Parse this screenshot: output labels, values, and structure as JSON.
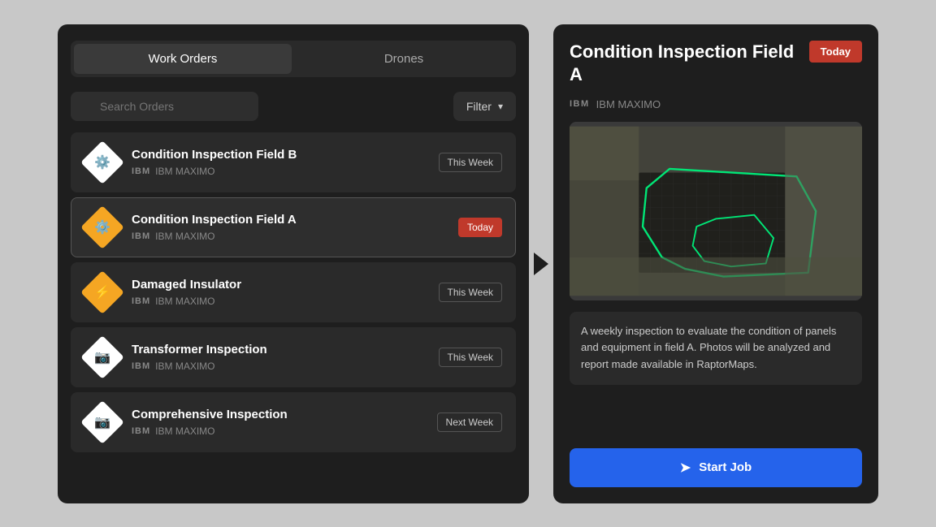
{
  "tabs": {
    "work_orders_label": "Work Orders",
    "drones_label": "Drones"
  },
  "search": {
    "placeholder": "Search Orders",
    "filter_label": "Filter"
  },
  "orders": [
    {
      "title": "Condition Inspection Field B",
      "source": "IBM MAXIMO",
      "badge": "This Week",
      "badge_type": "this-week",
      "icon_type": "gear",
      "icon_color": "white"
    },
    {
      "title": "Condition Inspection Field A",
      "source": "IBM MAXIMO",
      "badge": "Today",
      "badge_type": "today",
      "icon_type": "gear",
      "icon_color": "yellow",
      "selected": true
    },
    {
      "title": "Damaged Insulator",
      "source": "IBM MAXIMO",
      "badge": "This Week",
      "badge_type": "this-week",
      "icon_type": "lightning",
      "icon_color": "yellow"
    },
    {
      "title": "Transformer Inspection",
      "source": "IBM MAXIMO",
      "badge": "This Week",
      "badge_type": "this-week",
      "icon_type": "camera",
      "icon_color": "white"
    },
    {
      "title": "Comprehensive Inspection",
      "source": "IBM MAXIMO",
      "badge": "Next Week",
      "badge_type": "next-week",
      "icon_type": "camera",
      "icon_color": "white"
    }
  ],
  "detail": {
    "title": "Condition Inspection Field A",
    "badge": "Today",
    "source_logo": "IBM",
    "source_name": "IBM MAXIMO",
    "description": "A weekly inspection to evaluate the condition of panels and equipment in field A. Photos will be analyzed and report made available in RaptorMaps.",
    "start_job_label": "Start Job"
  }
}
